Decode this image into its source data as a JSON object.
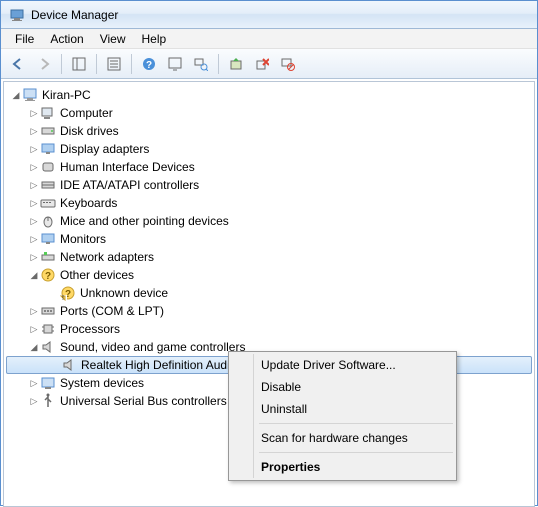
{
  "title": "Device Manager",
  "menu": {
    "file": "File",
    "action": "Action",
    "view": "View",
    "help": "Help"
  },
  "tree": {
    "root": "Kiran-PC",
    "items": [
      "Computer",
      "Disk drives",
      "Display adapters",
      "Human Interface Devices",
      "IDE ATA/ATAPI controllers",
      "Keyboards",
      "Mice and other pointing devices",
      "Monitors",
      "Network adapters",
      "Other devices",
      "Ports (COM & LPT)",
      "Processors",
      "Sound, video and game controllers",
      "System devices",
      "Universal Serial Bus controllers"
    ],
    "other_child": "Unknown device",
    "sound_child": "Realtek High Definition Audio"
  },
  "context": {
    "update": "Update Driver Software...",
    "disable": "Disable",
    "uninstall": "Uninstall",
    "scan": "Scan for hardware changes",
    "props": "Properties"
  }
}
